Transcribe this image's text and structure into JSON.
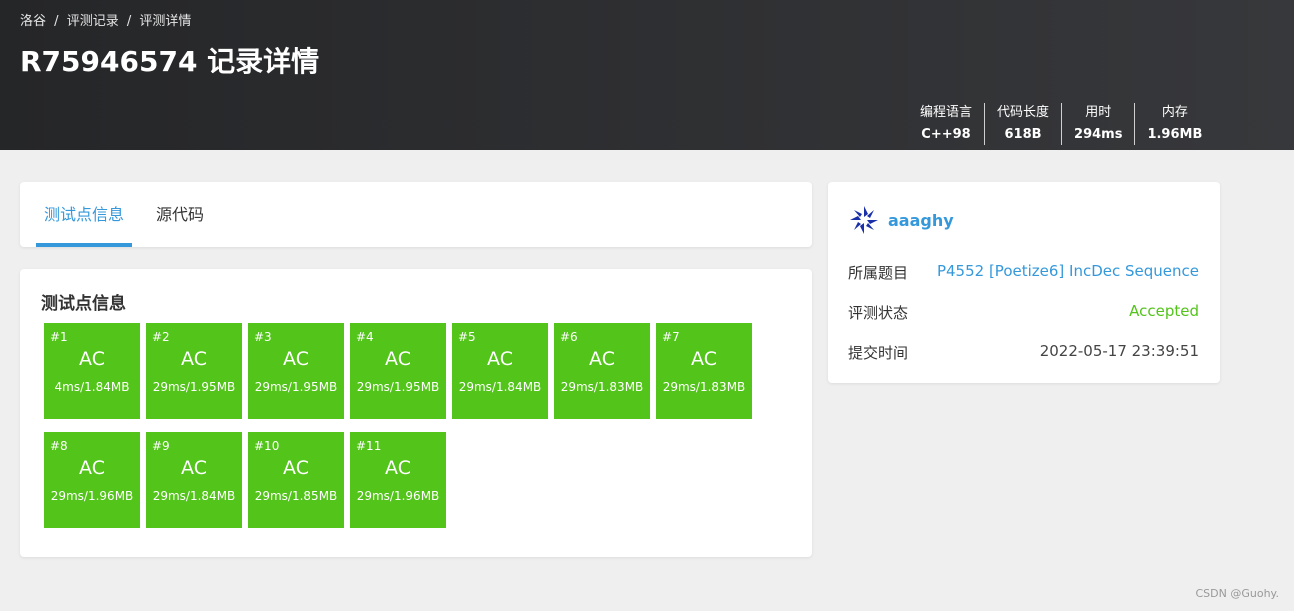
{
  "header": {
    "breadcrumb": [
      "洛谷",
      "评测记录",
      "评测详情"
    ],
    "breadcrumb_sep": "/",
    "title": "R75946574 记录详情",
    "stats": [
      {
        "label": "编程语言",
        "value": "C++98"
      },
      {
        "label": "代码长度",
        "value": "618B"
      },
      {
        "label": "用时",
        "value": "294ms"
      },
      {
        "label": "内存",
        "value": "1.96MB"
      }
    ]
  },
  "tabs": [
    {
      "label": "测试点信息",
      "active": true
    },
    {
      "label": "源代码",
      "active": false
    }
  ],
  "tests": {
    "title": "测试点信息",
    "color": "#52c41a",
    "cases": [
      {
        "num": "#1",
        "status": "AC",
        "meta": "4ms/1.84MB"
      },
      {
        "num": "#2",
        "status": "AC",
        "meta": "29ms/1.95MB"
      },
      {
        "num": "#3",
        "status": "AC",
        "meta": "29ms/1.95MB"
      },
      {
        "num": "#4",
        "status": "AC",
        "meta": "29ms/1.95MB"
      },
      {
        "num": "#5",
        "status": "AC",
        "meta": "29ms/1.84MB"
      },
      {
        "num": "#6",
        "status": "AC",
        "meta": "29ms/1.83MB"
      },
      {
        "num": "#7",
        "status": "AC",
        "meta": "29ms/1.83MB"
      },
      {
        "num": "#8",
        "status": "AC",
        "meta": "29ms/1.96MB"
      },
      {
        "num": "#9",
        "status": "AC",
        "meta": "29ms/1.84MB"
      },
      {
        "num": "#10",
        "status": "AC",
        "meta": "29ms/1.85MB"
      },
      {
        "num": "#11",
        "status": "AC",
        "meta": "29ms/1.96MB"
      }
    ]
  },
  "side": {
    "username": "aaaghy",
    "avatar_icon": "pinwheel-avatar-icon",
    "problem_label": "所属题目",
    "problem_value": "P4552 [Poetize6] IncDec Sequence",
    "status_label": "评测状态",
    "status_value": "Accepted",
    "time_label": "提交时间",
    "time_value": "2022-05-17 23:39:51"
  },
  "watermark": "CSDN @Guohy.",
  "colors": {
    "accent": "#3498db",
    "ac": "#52c41a",
    "header": "#2c2d2f"
  }
}
